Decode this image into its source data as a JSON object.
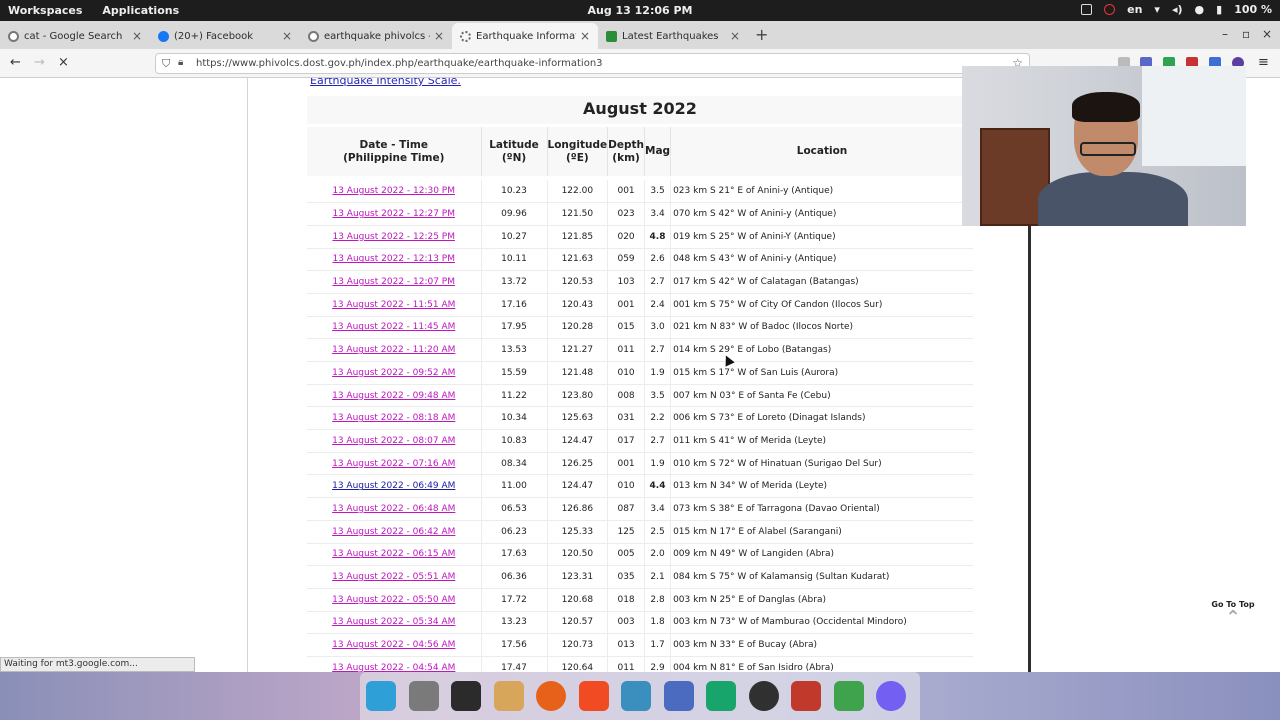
{
  "topbar": {
    "workspaces": "Workspaces",
    "applications": "Applications",
    "clock": "Aug 13  12:06 PM",
    "language": "en",
    "battery": "100 %"
  },
  "tabs": [
    {
      "label": "cat - Google Search",
      "icon": "google-icon",
      "color": "#e8e8e8"
    },
    {
      "label": "(20+) Facebook",
      "icon": "facebook-icon",
      "color": "#1877f2"
    },
    {
      "label": "earthquake phivolcs - Goog",
      "icon": "google-icon",
      "color": "#e8e8e8"
    },
    {
      "label": "Earthquake Information",
      "icon": "loading-icon",
      "color": "#6b6b6b"
    },
    {
      "label": "Latest Earthquakes",
      "icon": "usgs-icon",
      "color": "#2a8d3a"
    }
  ],
  "url": "https://www.phivolcs.dost.gov.ph/index.php/earthquake/earthquake-information3",
  "page": {
    "intensity_link": "Earthquake Intensity Scale.",
    "month_title": "August 2022",
    "headers": {
      "datetime_1": "Date - Time",
      "datetime_2": "(Philippine Time)",
      "lat_1": "Latitude",
      "lat_2": "(ºN)",
      "lon_1": "Longitude",
      "lon_2": "(ºE)",
      "depth_1": "Depth",
      "depth_2": "(km)",
      "mag": "Mag",
      "location": "Location"
    },
    "rows": [
      {
        "dt": "13 August 2022 - 12:30 PM",
        "lat": "10.23",
        "lon": "122.00",
        "depth": "001",
        "mag": "3.5",
        "loc": "023 km S 21° E of Anini-y (Antique)"
      },
      {
        "dt": "13 August 2022 - 12:27 PM",
        "lat": "09.96",
        "lon": "121.50",
        "depth": "023",
        "mag": "3.4",
        "loc": "070 km S 42° W of Anini-y (Antique)"
      },
      {
        "dt": "13 August 2022 - 12:25 PM",
        "lat": "10.27",
        "lon": "121.85",
        "depth": "020",
        "mag": "4.8",
        "loc": "019 km S 25° W of Anini-Y (Antique)"
      },
      {
        "dt": "13 August 2022 - 12:13 PM",
        "lat": "10.11",
        "lon": "121.63",
        "depth": "059",
        "mag": "2.6",
        "loc": "048 km S 43° W of Anini-y (Antique)"
      },
      {
        "dt": "13 August 2022 - 12:07 PM",
        "lat": "13.72",
        "lon": "120.53",
        "depth": "103",
        "mag": "2.7",
        "loc": "017 km S 42° W of Calatagan (Batangas)"
      },
      {
        "dt": "13 August 2022 - 11:51 AM",
        "lat": "17.16",
        "lon": "120.43",
        "depth": "001",
        "mag": "2.4",
        "loc": "001 km S 75° W of City Of Candon (Ilocos Sur)"
      },
      {
        "dt": "13 August 2022 - 11:45 AM",
        "lat": "17.95",
        "lon": "120.28",
        "depth": "015",
        "mag": "3.0",
        "loc": "021 km N 83° W of Badoc (Ilocos Norte)"
      },
      {
        "dt": "13 August 2022 - 11:20 AM",
        "lat": "13.53",
        "lon": "121.27",
        "depth": "011",
        "mag": "2.7",
        "loc": "014 km S 29° E of Lobo (Batangas)"
      },
      {
        "dt": "13 August 2022 - 09:52 AM",
        "lat": "15.59",
        "lon": "121.48",
        "depth": "010",
        "mag": "1.9",
        "loc": "015 km S 17° W of San Luis (Aurora)"
      },
      {
        "dt": "13 August 2022 - 09:48 AM",
        "lat": "11.22",
        "lon": "123.80",
        "depth": "008",
        "mag": "3.5",
        "loc": "007 km N 03° E of Santa Fe (Cebu)"
      },
      {
        "dt": "13 August 2022 - 08:18 AM",
        "lat": "10.34",
        "lon": "125.63",
        "depth": "031",
        "mag": "2.2",
        "loc": "006 km S 73° E of Loreto (Dinagat Islands)"
      },
      {
        "dt": "13 August 2022 - 08:07 AM",
        "lat": "10.83",
        "lon": "124.47",
        "depth": "017",
        "mag": "2.7",
        "loc": "011 km S 41° W of Merida (Leyte)"
      },
      {
        "dt": "13 August 2022 - 07:16 AM",
        "lat": "08.34",
        "lon": "126.25",
        "depth": "001",
        "mag": "1.9",
        "loc": "010 km S 72° W of Hinatuan (Surigao Del Sur)"
      },
      {
        "dt": "13 August 2022 - 06:49 AM",
        "lat": "11.00",
        "lon": "124.47",
        "depth": "010",
        "mag": "4.4",
        "loc": "013 km N 34° W of Merida (Leyte)"
      },
      {
        "dt": "13 August 2022 - 06:48 AM",
        "lat": "06.53",
        "lon": "126.86",
        "depth": "087",
        "mag": "3.4",
        "loc": "073 km S 38° E of Tarragona (Davao Oriental)"
      },
      {
        "dt": "13 August 2022 - 06:42 AM",
        "lat": "06.23",
        "lon": "125.33",
        "depth": "125",
        "mag": "2.5",
        "loc": "015 km N 17° E of Alabel (Sarangani)"
      },
      {
        "dt": "13 August 2022 - 06:15 AM",
        "lat": "17.63",
        "lon": "120.50",
        "depth": "005",
        "mag": "2.0",
        "loc": "009 km N 49° W of Langiden (Abra)"
      },
      {
        "dt": "13 August 2022 - 05:51 AM",
        "lat": "06.36",
        "lon": "123.31",
        "depth": "035",
        "mag": "2.1",
        "loc": "084 km S 75° W of Kalamansig (Sultan Kudarat)"
      },
      {
        "dt": "13 August 2022 - 05:50 AM",
        "lat": "17.72",
        "lon": "120.68",
        "depth": "018",
        "mag": "2.8",
        "loc": "003 km N 25° E of Danglas (Abra)"
      },
      {
        "dt": "13 August 2022 - 05:34 AM",
        "lat": "13.23",
        "lon": "120.57",
        "depth": "003",
        "mag": "1.8",
        "loc": "003 km N 73° W of Mamburao (Occidental Mindoro)"
      },
      {
        "dt": "13 August 2022 - 04:56 AM",
        "lat": "17.56",
        "lon": "120.73",
        "depth": "013",
        "mag": "1.7",
        "loc": "003 km N 33° E of Bucay (Abra)"
      },
      {
        "dt": "13 August 2022 - 04:54 AM",
        "lat": "17.47",
        "lon": "120.64",
        "depth": "011",
        "mag": "2.9",
        "loc": "004 km N 81° E of San Isidro (Abra)"
      }
    ],
    "go_to_top": "Go To Top",
    "status": "Waiting for mt3.google.com..."
  },
  "dock": [
    {
      "name": "app-grid-icon",
      "color": "#2f9fd8"
    },
    {
      "name": "files-icon",
      "color": "#7a7a7a"
    },
    {
      "name": "terminal-icon",
      "color": "#2b2b2b"
    },
    {
      "name": "archive-icon",
      "color": "#d7a65a"
    },
    {
      "name": "firefox-icon",
      "color": "#e8611a"
    },
    {
      "name": "brave-icon",
      "color": "#f04b23"
    },
    {
      "name": "screenshot-icon",
      "color": "#3a8fbf"
    },
    {
      "name": "kdenlive-icon",
      "color": "#4a6bbf"
    },
    {
      "name": "pycharm-icon",
      "color": "#18a56b"
    },
    {
      "name": "obs-icon",
      "color": "#303030"
    },
    {
      "name": "audio-icon",
      "color": "#c0392b"
    },
    {
      "name": "layers-icon",
      "color": "#3fa34d"
    },
    {
      "name": "viber-icon",
      "color": "#7360f2"
    }
  ]
}
